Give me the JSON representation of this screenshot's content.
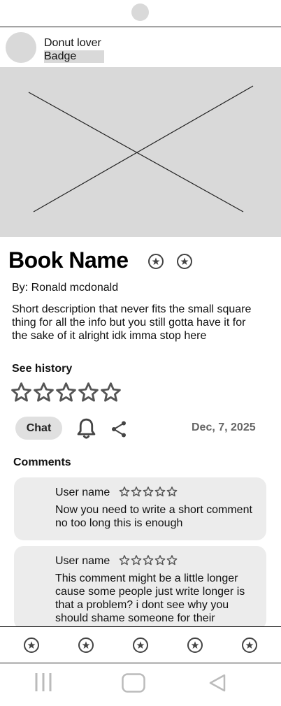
{
  "profile": {
    "username": "Donut lover",
    "badge": "Badge"
  },
  "book": {
    "title": "Book Name",
    "author": "By: Ronald mcdonald",
    "description": "Short description that never fits the small square thing for all the info but you still gotta have it for the sake of it alright idk imma stop here",
    "see_history": "See history",
    "rating": 0,
    "rating_max": 5
  },
  "actions": {
    "chat_label": "Chat",
    "date": "Dec, 7, 2025"
  },
  "comments": {
    "heading": "Comments",
    "items": [
      {
        "user": "User name",
        "rating": 0,
        "text": "Now you need to write a short comment no too long this is enough"
      },
      {
        "user": "User name",
        "rating": 0,
        "text": "This comment might be a little longer cause some people just write longer is that a problem? i dont see why you should shame someone for their"
      }
    ]
  },
  "icons": {
    "title_actions": [
      "star-circle-icon",
      "star-circle-icon"
    ],
    "rating_star": "star-outline-icon",
    "bell": "bell-icon",
    "share": "share-icon",
    "bottom_nav": [
      "star-circle-icon",
      "star-circle-icon",
      "star-circle-icon",
      "star-circle-icon",
      "star-circle-icon"
    ],
    "system_nav": [
      "recent-apps-icon",
      "home-icon",
      "back-icon"
    ]
  },
  "colors": {
    "placeholder_gray": "#d9d9d9",
    "card_gray": "#ececec",
    "chat_button": "#e0e0e0",
    "icon_dark": "#444444",
    "date_gray": "#666666"
  }
}
